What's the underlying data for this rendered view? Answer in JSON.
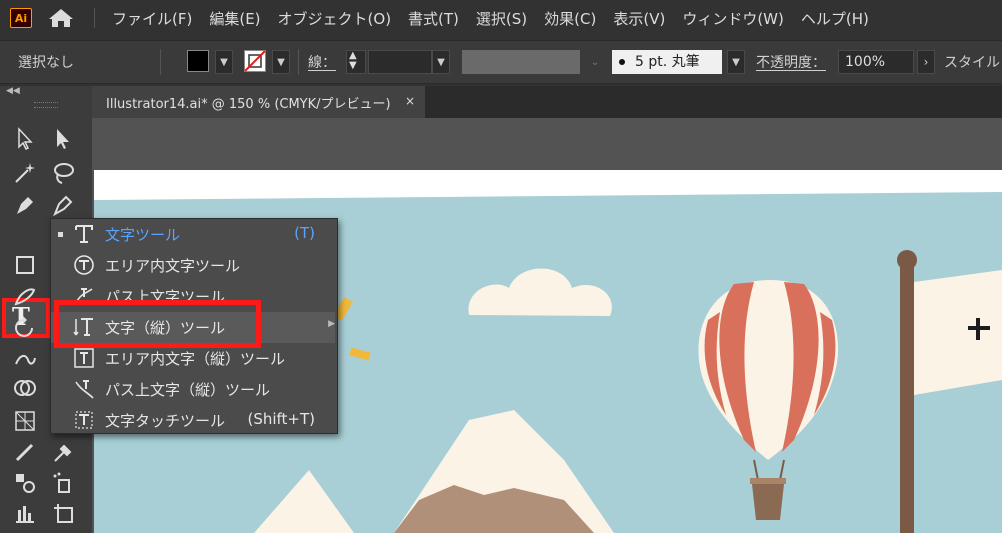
{
  "app": {
    "logo": "Ai"
  },
  "menubar": {
    "items": [
      "ファイル(F)",
      "編集(E)",
      "オブジェクト(O)",
      "書式(T)",
      "選択(S)",
      "効果(C)",
      "表示(V)",
      "ウィンドウ(W)",
      "ヘルプ(H)"
    ]
  },
  "controlbar": {
    "selection": "選択なし",
    "stroke_label": "線：",
    "brush": "5 pt. 丸筆",
    "opacity_label": "不透明度：",
    "opacity": "100%",
    "style_label": "スタイル"
  },
  "tab": {
    "title": "Illustrator14.ai* @ 150 % (CMYK/プレビュー)",
    "close": "×"
  },
  "type_tool": {
    "glyph": "T"
  },
  "flyout": {
    "items": [
      {
        "label": "文字ツール",
        "shortcut": "(T)",
        "icon": "type-icon"
      },
      {
        "label": "エリア内文字ツール",
        "shortcut": "",
        "icon": "area-type-icon"
      },
      {
        "label": "パス上文字ツール",
        "shortcut": "",
        "icon": "type-on-path-icon"
      },
      {
        "label": "文字（縦）ツール",
        "shortcut": "",
        "icon": "vertical-type-icon"
      },
      {
        "label": "エリア内文字（縦）ツール",
        "shortcut": "",
        "icon": "vertical-area-type-icon"
      },
      {
        "label": "パス上文字（縦）ツール",
        "shortcut": "",
        "icon": "vertical-type-on-path-icon"
      },
      {
        "label": "文字タッチツール",
        "shortcut": "(Shift+T)",
        "icon": "touch-type-icon"
      }
    ]
  },
  "colors": {
    "fill": "#000000",
    "sky": "#a8ced6",
    "balloon_stripe": "#d9705c",
    "highlight": "#ff1a1a",
    "accent": "#5aa3ff"
  }
}
